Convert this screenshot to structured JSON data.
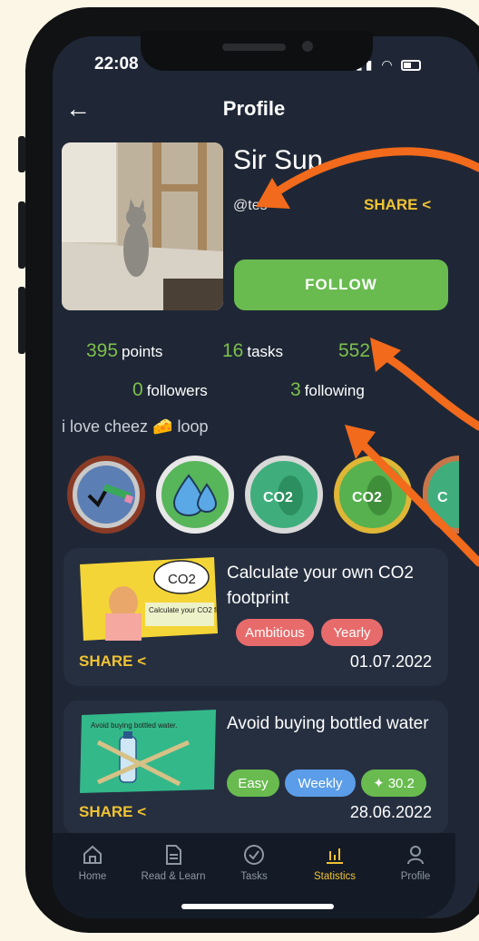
{
  "status_bar": {
    "time": "22:08"
  },
  "header": {
    "title": "Profile"
  },
  "profile": {
    "name": "Sir Sup",
    "handle": "@tes",
    "share_label": "SHARE",
    "follow_label": "FOLLOW"
  },
  "stats": {
    "points": {
      "value": "395",
      "label": "points"
    },
    "tasks": {
      "value": "16",
      "label": "tasks"
    },
    "third": {
      "value": "552",
      "label": ""
    },
    "followers": {
      "value": "0",
      "label": "followers"
    },
    "following": {
      "value": "3",
      "label": "following"
    }
  },
  "bio": "i love cheez 🧀 loop",
  "badges": [
    {
      "icon": "checkmark-pencil-icon"
    },
    {
      "icon": "water-drops-icon"
    },
    {
      "icon": "co2-footprint-icon",
      "text": "CO2"
    },
    {
      "icon": "co2-footprint-gold-icon",
      "text": "CO2"
    },
    {
      "icon": "co2-footprint-partial-icon",
      "text": "C"
    }
  ],
  "cards": [
    {
      "title": "Calculate your own CO2 footprint",
      "image_caption": "Calculate your CO2 footprint.",
      "image_bubble": "CO2",
      "tags": [
        {
          "label": "Ambitious",
          "color": "#e86b6b"
        },
        {
          "label": "Yearly",
          "color": "#e86b6b"
        }
      ],
      "share_label": "SHARE",
      "date": "01.07.2022"
    },
    {
      "title": "Avoid buying bottled water",
      "image_caption": "Avoid buying bottled water.",
      "tags": [
        {
          "label": "Easy",
          "color": "#69bb4f"
        },
        {
          "label": "Weekly",
          "color": "#5b9de8"
        },
        {
          "label": "30.2",
          "color": "#69bb4f"
        }
      ],
      "share_label": "SHARE",
      "date": "28.06.2022"
    }
  ],
  "nav": [
    {
      "label": "Home",
      "icon": "home-icon",
      "active": false
    },
    {
      "label": "Read & Learn",
      "icon": "document-icon",
      "active": false
    },
    {
      "label": "Tasks",
      "icon": "check-circle-icon",
      "active": false
    },
    {
      "label": "Statistics",
      "icon": "bar-chart-icon",
      "active": true
    },
    {
      "label": "Profile",
      "icon": "person-icon",
      "active": false
    }
  ],
  "colors": {
    "background": "#fbf6e6",
    "screen": "#1f2736",
    "accent_green": "#7cc04b",
    "accent_yellow": "#f0c232",
    "annotation_orange": "#f26a1b"
  }
}
